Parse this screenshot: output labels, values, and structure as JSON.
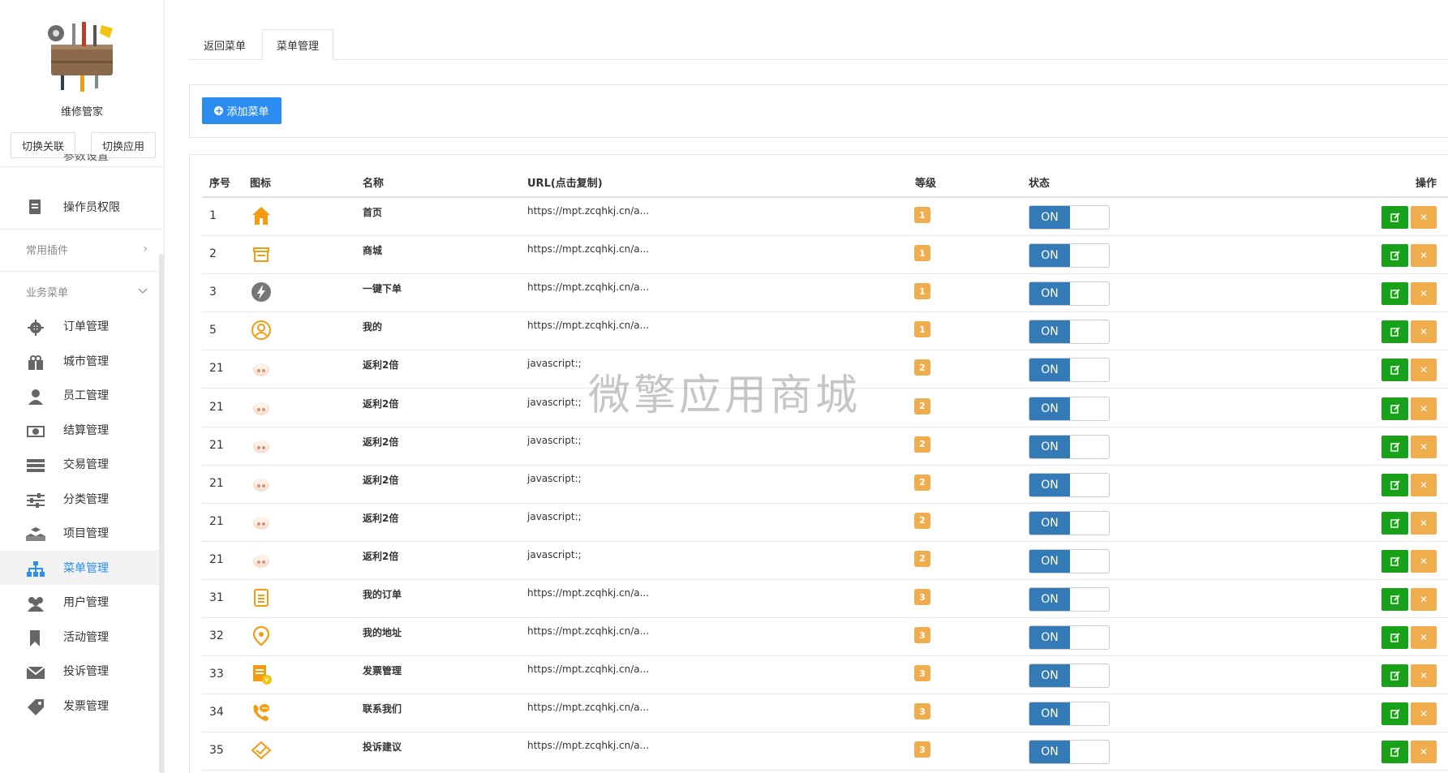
{
  "sidebar": {
    "app_name": "维修管家",
    "switch_link_label": "切换关联",
    "switch_app_label": "切换应用",
    "partial_item_label": "参数设置",
    "operator_item_label": "操作员权限",
    "group_plugins": "常用插件",
    "group_business": "业务菜单",
    "items": [
      {
        "label": "订单管理",
        "icon": "gear-icon"
      },
      {
        "label": "城市管理",
        "icon": "gift-icon"
      },
      {
        "label": "员工管理",
        "icon": "user-icon"
      },
      {
        "label": "结算管理",
        "icon": "money-icon"
      },
      {
        "label": "交易管理",
        "icon": "list-icon"
      },
      {
        "label": "分类管理",
        "icon": "sliders-icon"
      },
      {
        "label": "项目管理",
        "icon": "cubes-icon"
      },
      {
        "label": "菜单管理",
        "icon": "sitemap-icon",
        "active": true
      },
      {
        "label": "用户管理",
        "icon": "users-icon"
      },
      {
        "label": "活动管理",
        "icon": "bookmark-icon"
      },
      {
        "label": "投诉管理",
        "icon": "envelope-icon"
      },
      {
        "label": "发票管理",
        "icon": "tag-icon"
      }
    ]
  },
  "tabs": [
    {
      "label": "返回菜单"
    },
    {
      "label": "菜单管理",
      "active": true
    }
  ],
  "toolbar": {
    "add_label": "添加菜单"
  },
  "table": {
    "headers": [
      "序号",
      "图标",
      "名称",
      "URL(点击复制)",
      "等级",
      "状态",
      "操作"
    ],
    "switch_label": "ON",
    "rows": [
      {
        "id": "1",
        "icon": "home-icon",
        "name": "首页",
        "url": "https://mpt.zcqhkj.cn/a...",
        "level": "1"
      },
      {
        "id": "2",
        "icon": "shop-icon",
        "name": "商城",
        "url": "https://mpt.zcqhkj.cn/a...",
        "level": "1"
      },
      {
        "id": "3",
        "icon": "bolt-icon",
        "name": "一键下单",
        "url": "https://mpt.zcqhkj.cn/a...",
        "level": "1"
      },
      {
        "id": "5",
        "icon": "person-icon",
        "name": "我的",
        "url": "https://mpt.zcqhkj.cn/a...",
        "level": "1"
      },
      {
        "id": "21",
        "icon": "piggy-icon",
        "name": "返利2倍",
        "url": "javascript:;",
        "level": "2"
      },
      {
        "id": "21",
        "icon": "piggy-icon",
        "name": "返利2倍",
        "url": "javascript:;",
        "level": "2"
      },
      {
        "id": "21",
        "icon": "piggy-icon",
        "name": "返利2倍",
        "url": "javascript:;",
        "level": "2"
      },
      {
        "id": "21",
        "icon": "piggy-icon",
        "name": "返利2倍",
        "url": "javascript:;",
        "level": "2"
      },
      {
        "id": "21",
        "icon": "piggy-icon",
        "name": "返利2倍",
        "url": "javascript:;",
        "level": "2"
      },
      {
        "id": "21",
        "icon": "piggy-icon",
        "name": "返利2倍",
        "url": "javascript:;",
        "level": "2"
      },
      {
        "id": "31",
        "icon": "orders-icon",
        "name": "我的订单",
        "url": "https://mpt.zcqhkj.cn/a...",
        "level": "3"
      },
      {
        "id": "32",
        "icon": "location-icon",
        "name": "我的地址",
        "url": "https://mpt.zcqhkj.cn/a...",
        "level": "3"
      },
      {
        "id": "33",
        "icon": "invoice-icon",
        "name": "发票管理",
        "url": "https://mpt.zcqhkj.cn/a...",
        "level": "3"
      },
      {
        "id": "34",
        "icon": "phone-icon",
        "name": "联系我们",
        "url": "https://mpt.zcqhkj.cn/a...",
        "level": "3"
      },
      {
        "id": "35",
        "icon": "feedback-icon",
        "name": "投诉建议",
        "url": "https://mpt.zcqhkj.cn/a...",
        "level": "3"
      }
    ]
  },
  "watermark": "微擎应用商城",
  "colors": {
    "primary": "#2d8cf0",
    "switch_on": "#337ab7",
    "edit": "#1aa11a",
    "delete": "#f0ad4e",
    "level": "#f0ad4e",
    "icon_orange": "#f39c12"
  }
}
